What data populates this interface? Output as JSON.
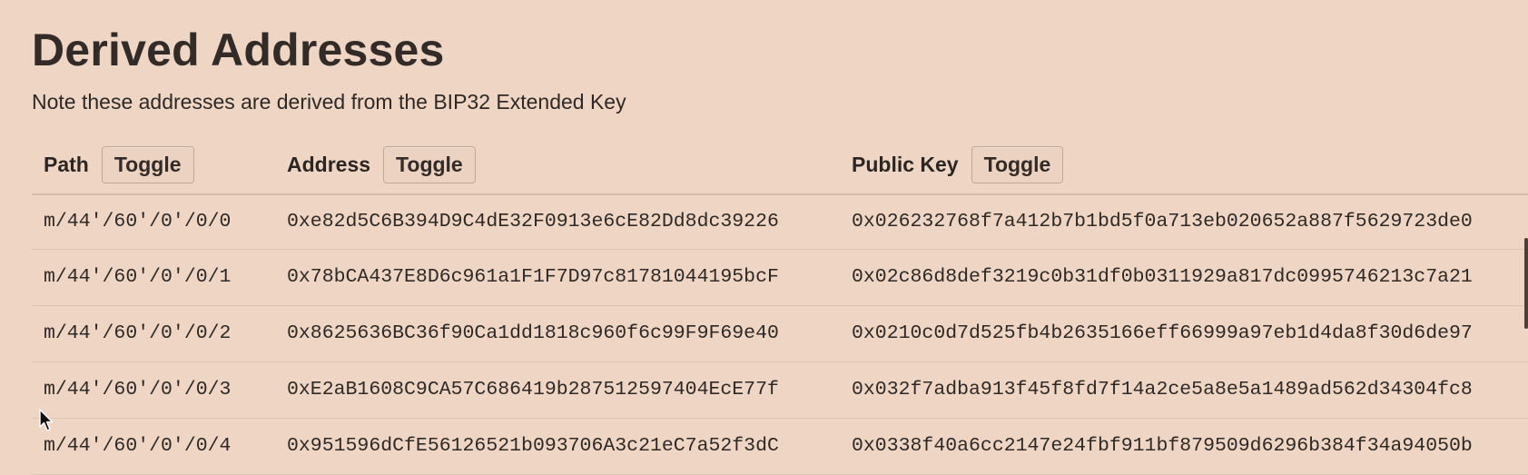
{
  "section": {
    "title": "Derived Addresses",
    "note": "Note these addresses are derived from the BIP32 Extended Key"
  },
  "table": {
    "headers": {
      "path": "Path",
      "address": "Address",
      "public_key": "Public Key",
      "toggle": "Toggle"
    },
    "rows": [
      {
        "path": "m/44'/60'/0'/0/0",
        "address": "0xe82d5C6B394D9C4dE32F0913e6cE82Dd8dc39226",
        "public_key": "0x026232768f7a412b7b1bd5f0a713eb020652a887f5629723de0"
      },
      {
        "path": "m/44'/60'/0'/0/1",
        "address": "0x78bCA437E8D6c961a1F1F7D97c81781044195bcF",
        "public_key": "0x02c86d8def3219c0b31df0b0311929a817dc0995746213c7a21"
      },
      {
        "path": "m/44'/60'/0'/0/2",
        "address": "0x8625636BC36f90Ca1dd1818c960f6c99F9F69e40",
        "public_key": "0x0210c0d7d525fb4b2635166eff66999a97eb1d4da8f30d6de97"
      },
      {
        "path": "m/44'/60'/0'/0/3",
        "address": "0xE2aB1608C9CA57C686419b287512597404EcE77f",
        "public_key": "0x032f7adba913f45f8fd7f14a2ce5a8e5a1489ad562d34304fc8"
      },
      {
        "path": "m/44'/60'/0'/0/4",
        "address": "0x951596dCfE56126521b093706A3c21eC7a52f3dC",
        "public_key": "0x0338f40a6cc2147e24fbf911bf879509d6296b384f34a94050b"
      }
    ]
  },
  "icons": {
    "cursor": "mouse-pointer-icon"
  },
  "colors": {
    "background": "#efd6c4",
    "text": "#2b2623",
    "button_border": "#bea896"
  }
}
